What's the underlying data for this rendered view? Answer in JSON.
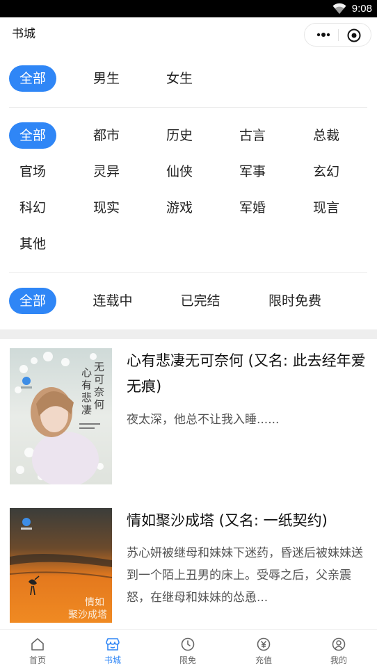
{
  "status_bar": {
    "time": "9:08"
  },
  "nav": {
    "title": "书城"
  },
  "channels": [
    {
      "label": "全部",
      "active": true
    },
    {
      "label": "男生",
      "active": false
    },
    {
      "label": "女生",
      "active": false
    }
  ],
  "categories": [
    {
      "label": "全部",
      "active": true
    },
    {
      "label": "都市",
      "active": false
    },
    {
      "label": "历史",
      "active": false
    },
    {
      "label": "古言",
      "active": false
    },
    {
      "label": "总裁",
      "active": false
    },
    {
      "label": "官场",
      "active": false
    },
    {
      "label": "灵异",
      "active": false
    },
    {
      "label": "仙侠",
      "active": false
    },
    {
      "label": "军事",
      "active": false
    },
    {
      "label": "玄幻",
      "active": false
    },
    {
      "label": "科幻",
      "active": false
    },
    {
      "label": "现实",
      "active": false
    },
    {
      "label": "游戏",
      "active": false
    },
    {
      "label": "军婚",
      "active": false
    },
    {
      "label": "现言",
      "active": false
    },
    {
      "label": "其他",
      "active": false
    }
  ],
  "statuses": [
    {
      "label": "全部",
      "active": true
    },
    {
      "label": "连载中",
      "active": false
    },
    {
      "label": "已完结",
      "active": false
    },
    {
      "label": "限时免费",
      "active": false
    }
  ],
  "books": [
    {
      "title": "心有悲凄无可奈何 (又名: 此去经年爱无痕)",
      "description": "夜太深，他总不让我入睡......",
      "cover_text_a": "心有悲凄",
      "cover_text_b": "无可奈何"
    },
    {
      "title": "情如聚沙成塔 (又名: 一纸契约)",
      "description": "苏心妍被继母和妹妹下迷药，昏迷后被妹妹送到一个陌上丑男的床上。受辱之后，父亲震怒，在继母和妹妹的怂恿...",
      "cover_text_a": "情如",
      "cover_text_b": "聚沙成塔"
    }
  ],
  "tabs": [
    {
      "label": "首页",
      "icon": "home-icon",
      "active": false
    },
    {
      "label": "书城",
      "icon": "bookstore-icon",
      "active": true
    },
    {
      "label": "限免",
      "icon": "clock-icon",
      "active": false
    },
    {
      "label": "充值",
      "icon": "yuan-icon",
      "active": false
    },
    {
      "label": "我的",
      "icon": "profile-icon",
      "active": false
    }
  ],
  "colors": {
    "accent": "#2f86f6",
    "inactive_tab": "#666666"
  }
}
